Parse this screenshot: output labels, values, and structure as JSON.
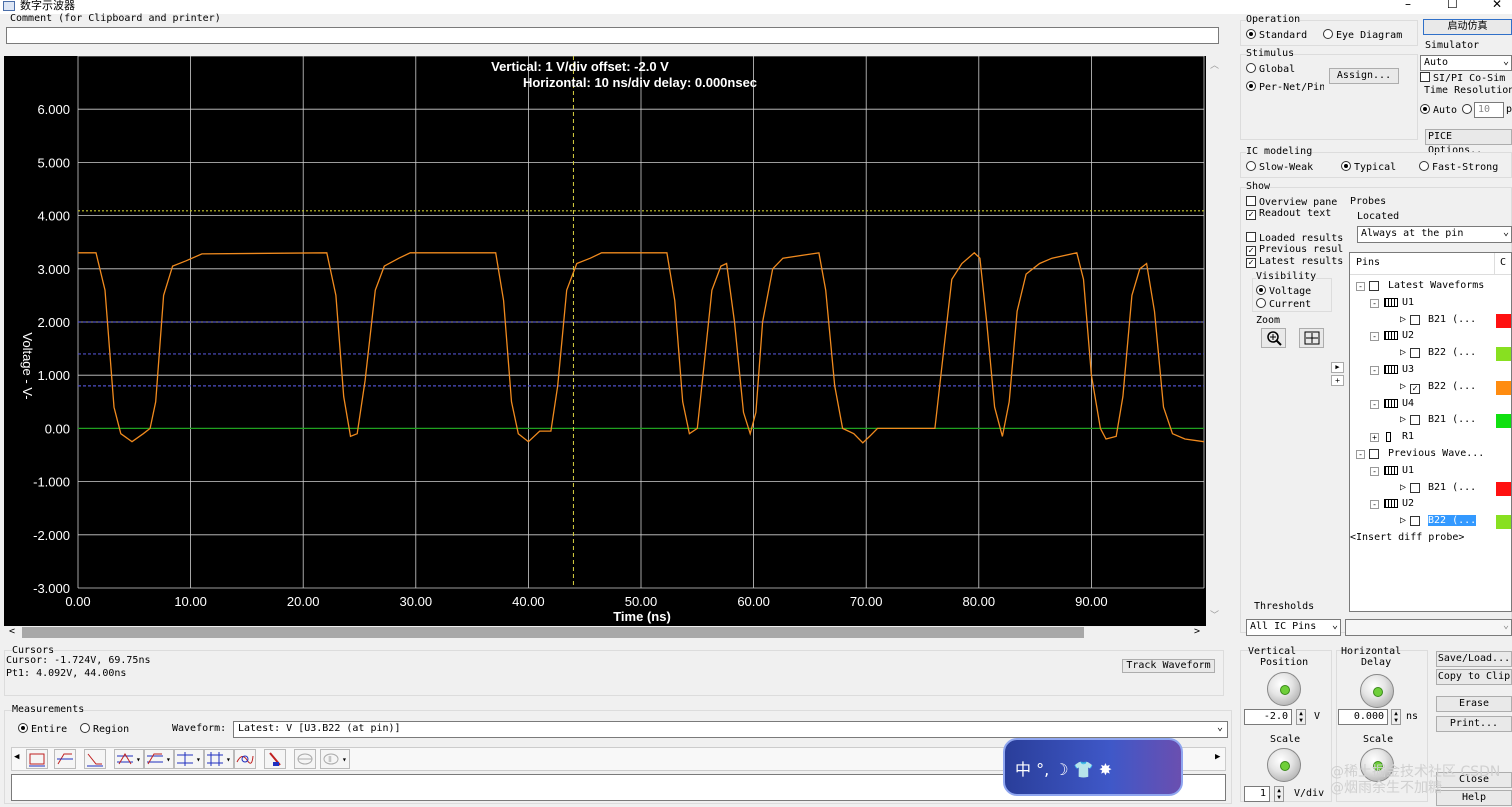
{
  "window": {
    "title": "数字示波器"
  },
  "comment": {
    "label": "Comment (for Clipboard and printer)",
    "value": ""
  },
  "scope": {
    "header_line1": "Vertical: 1  V/div  offset: -2.0 V",
    "header_line2": "Horizontal: 10 ns/div  delay: 0.000nsec",
    "ylabel": "Voltage - V-",
    "xlabel": "Time  (ns)",
    "yticks": [
      "6.000",
      "5.000",
      "4.000",
      "3.000",
      "2.000",
      "1.000",
      "0.00",
      "-1.000",
      "-2.000",
      "-3.000"
    ],
    "xticks": [
      "0.00",
      "10.00",
      "20.00",
      "30.00",
      "40.00",
      "50.00",
      "60.00",
      "70.00",
      "80.00",
      "90.00"
    ]
  },
  "chart_data": {
    "type": "line",
    "title": "",
    "xlabel": "Time  (ns)",
    "ylabel": "Voltage - V-",
    "xlim": [
      0,
      100
    ],
    "ylim": [
      -3,
      7
    ],
    "grid": true,
    "series": [
      {
        "points": [
          [
            0,
            3.3
          ],
          [
            1.6,
            3.3
          ],
          [
            2.4,
            2.6
          ],
          [
            3.2,
            0.4
          ],
          [
            3.8,
            -0.1
          ],
          [
            4.8,
            -0.25
          ],
          [
            5.8,
            -0.1
          ],
          [
            6.4,
            0.0
          ],
          [
            6.9,
            0.5
          ],
          [
            7.6,
            2.5
          ],
          [
            8.4,
            3.05
          ],
          [
            9.6,
            3.15
          ],
          [
            11,
            3.28
          ],
          [
            22.1,
            3.3
          ],
          [
            22.9,
            2.5
          ],
          [
            23.6,
            0.6
          ],
          [
            24.2,
            -0.15
          ],
          [
            24.8,
            -0.1
          ],
          [
            25.5,
            0.9
          ],
          [
            26.4,
            2.6
          ],
          [
            27.2,
            3.05
          ],
          [
            28.5,
            3.2
          ],
          [
            29.5,
            3.3
          ],
          [
            37.1,
            3.3
          ],
          [
            37.8,
            2.4
          ],
          [
            38.5,
            0.5
          ],
          [
            39.1,
            -0.1
          ],
          [
            40.0,
            -0.25
          ],
          [
            41,
            -0.05
          ],
          [
            42,
            -0.05
          ],
          [
            42.6,
            0.8
          ],
          [
            43.4,
            2.6
          ],
          [
            44.3,
            3.1
          ],
          [
            45.5,
            3.2
          ],
          [
            46.5,
            3.3
          ],
          [
            52.3,
            3.3
          ],
          [
            53,
            2.4
          ],
          [
            53.7,
            0.5
          ],
          [
            54.3,
            -0.1
          ],
          [
            55,
            0.0
          ],
          [
            55.6,
            1.2
          ],
          [
            56.3,
            2.6
          ],
          [
            57.1,
            3.05
          ],
          [
            57.6,
            3.1
          ],
          [
            58.3,
            2.0
          ],
          [
            59.1,
            0.3
          ],
          [
            59.7,
            -0.1
          ],
          [
            60.2,
            0.3
          ],
          [
            60.8,
            2.0
          ],
          [
            61.7,
            3.0
          ],
          [
            62.6,
            3.2
          ],
          [
            65.8,
            3.3
          ],
          [
            66.4,
            2.6
          ],
          [
            67.2,
            0.8
          ],
          [
            67.9,
            0.0
          ],
          [
            68.9,
            -0.1
          ],
          [
            69.7,
            -0.27
          ],
          [
            70.3,
            -0.15
          ],
          [
            71,
            0.0
          ],
          [
            76.1,
            0.0
          ],
          [
            76.9,
            1.5
          ],
          [
            77.6,
            2.8
          ],
          [
            78.5,
            3.1
          ],
          [
            79.6,
            3.3
          ],
          [
            80.1,
            3.2
          ],
          [
            80.7,
            2.0
          ],
          [
            81.4,
            0.4
          ],
          [
            82.1,
            -0.15
          ],
          [
            82.7,
            0.5
          ],
          [
            83.4,
            2.2
          ],
          [
            84.2,
            2.9
          ],
          [
            85.4,
            3.1
          ],
          [
            86.5,
            3.2
          ],
          [
            88.7,
            3.3
          ],
          [
            89.3,
            2.8
          ],
          [
            90,
            1.0
          ],
          [
            90.8,
            0.0
          ],
          [
            91.3,
            -0.2
          ],
          [
            92.2,
            -0.15
          ],
          [
            92.8,
            0.6
          ],
          [
            93.6,
            2.5
          ],
          [
            94.3,
            3.0
          ],
          [
            94.9,
            3.1
          ],
          [
            95.6,
            2.2
          ],
          [
            96.4,
            0.4
          ],
          [
            97.2,
            -0.1
          ],
          [
            98.3,
            -0.2
          ],
          [
            100,
            -0.25
          ]
        ]
      }
    ],
    "reference_lines": [
      {
        "y": 4.09,
        "style": "dotted",
        "color": "#c8c832"
      },
      {
        "y": 2.0,
        "style": "dashed",
        "color": "#5050c8"
      },
      {
        "y": 1.4,
        "style": "dashed",
        "color": "#5050c8"
      },
      {
        "y": 0.8,
        "style": "dashed",
        "color": "#5050c8"
      },
      {
        "y": 0.0,
        "style": "solid",
        "color": "#20a020"
      }
    ],
    "cursor_x": 44.0
  },
  "operation": {
    "label": "Operation",
    "standard": "Standard",
    "eye": "Eye Diagram"
  },
  "stimulus": {
    "label": "Stimulus",
    "global": "Global",
    "pernet": "Per-Net/Pin",
    "assign": "Assign..."
  },
  "start_sim": "启动仿真",
  "simulator": {
    "label": "Simulator",
    "value": "Auto",
    "sipi": "SI/PI Co-Sim",
    "time_res": "Time Resolution",
    "auto": "Auto",
    "res_value": "10",
    "res_unit": "p",
    "spice": "PICE Options.."
  },
  "ic": {
    "label": "IC modeling",
    "slow": "Slow-Weak",
    "typical": "Typical",
    "fast": "Fast-Strong"
  },
  "show": {
    "label": "Show",
    "overview": "Overview pane",
    "readout": "Readout text",
    "loaded": "Loaded results",
    "previous": "Previous resul",
    "latest": "Latest results",
    "visibility": "Visibility",
    "voltage": "Voltage",
    "current": "Current",
    "zoom": "Zoom"
  },
  "probes": {
    "label": "Probes",
    "located": "Located",
    "located_value": "Always at the pin",
    "col_pins": "Pins",
    "col_c": "C",
    "tree": [
      {
        "indent": 0,
        "pm": "-",
        "chk": true,
        "text": "Latest Waveforms"
      },
      {
        "indent": 1,
        "pm": "-",
        "ic": true,
        "text": "U1"
      },
      {
        "indent": 2,
        "pin": true,
        "checked": false,
        "text": "B21 (...",
        "color": "#ff1010"
      },
      {
        "indent": 1,
        "pm": "-",
        "ic": true,
        "text": "U2"
      },
      {
        "indent": 2,
        "pin": true,
        "checked": false,
        "text": "B22 (...",
        "color": "#88e020"
      },
      {
        "indent": 1,
        "pm": "-",
        "ic": true,
        "text": "U3"
      },
      {
        "indent": 2,
        "pin": true,
        "checked": true,
        "text": "B22 (...",
        "color": "#ff8c10"
      },
      {
        "indent": 1,
        "pm": "-",
        "ic": true,
        "text": "U4"
      },
      {
        "indent": 2,
        "pin": true,
        "checked": false,
        "text": "B21 (...",
        "color": "#10e010"
      },
      {
        "indent": 1,
        "pm": "+",
        "res": true,
        "text": "R1"
      },
      {
        "indent": 0,
        "pm": "-",
        "chk": true,
        "text": "Previous Wave..."
      },
      {
        "indent": 1,
        "pm": "-",
        "ic": true,
        "text": "U1"
      },
      {
        "indent": 2,
        "pin": true,
        "checked": false,
        "text": "B21 (...",
        "color": "#ff1010"
      },
      {
        "indent": 1,
        "pm": "-",
        "ic": true,
        "text": "U2"
      },
      {
        "indent": 2,
        "pin": true,
        "checked": false,
        "text": "B22 (...",
        "color": "#88e020",
        "selected": true
      },
      {
        "indent": 0,
        "text": "<Insert diff probe>"
      }
    ]
  },
  "thresholds": {
    "label": "Thresholds",
    "value": "All IC Pins"
  },
  "cursors": {
    "label": "Cursors",
    "line1": "Cursor: -1.724V, 69.75ns",
    "line2": "Pt1: 4.092V, 44.00ns",
    "track": "Track Waveform"
  },
  "measurements": {
    "label": "Measurements",
    "entire": "Entire",
    "region": "Region",
    "waveform_label": "Waveform:",
    "waveform_value": "Latest: V [U3.B22 (at pin)]"
  },
  "vertical": {
    "label1": "Vertical",
    "label2": "Position",
    "value": "-2.0",
    "unit": "V",
    "scale": "Scale",
    "scale_value": "1",
    "scale_unit": "V/div"
  },
  "horizontal": {
    "label1": "Horizontal",
    "label2": "Delay",
    "value": "0.000",
    "unit": "ns",
    "scale": "Scale"
  },
  "right_buttons": {
    "save": "Save/Load...",
    "copy": "Copy to Clip",
    "erase": "Erase",
    "print": "Print...",
    "close": "Close",
    "help": "Help"
  },
  "ime": {
    "text": "中 °, ☽ 👕 ✸"
  },
  "watermark": "@稀土掘金技术社区  CSDN @烟雨余生不加糖"
}
